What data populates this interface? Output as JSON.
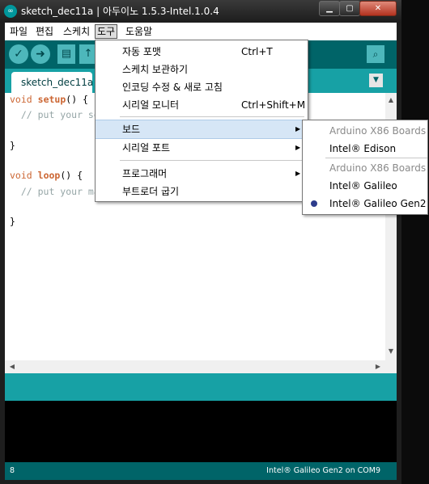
{
  "window": {
    "title": "sketch_dec11a | 아두이노 1.5.3-Intel.1.0.4",
    "app_icon_glyph": "∞",
    "min_glyph": "▁",
    "max_glyph": "▢",
    "close_glyph": "✕"
  },
  "menubar": {
    "items": [
      "파일",
      "편집",
      "스케치",
      "도구",
      "도움말"
    ],
    "active": "도구"
  },
  "toolbar": {
    "verify_glyph": "✓",
    "upload_glyph": "➜",
    "new_glyph": "▤",
    "open_glyph": "↑",
    "serial_glyph": "⌕"
  },
  "tabs": {
    "active_tab": "sketch_dec11a",
    "menu_glyph": "▼"
  },
  "editor": {
    "lines": [
      {
        "kw": "void",
        "fn": "setup",
        "rest": "() {"
      },
      {
        "comment": "  // put your setu"
      },
      {
        "text": ""
      },
      {
        "text": "}"
      },
      {
        "text": ""
      },
      {
        "kw": "void",
        "fn": "loop",
        "rest": "() {"
      },
      {
        "comment": "  // put your main"
      },
      {
        "text": ""
      },
      {
        "text": "}"
      }
    ]
  },
  "tools_menu": {
    "items": [
      {
        "label": "자동 포맷",
        "shortcut": "Ctrl+T"
      },
      {
        "label": "스케치 보관하기",
        "shortcut": ""
      },
      {
        "label": "인코딩 수정 & 새로 고침",
        "shortcut": ""
      },
      {
        "label": "시리얼 모니터",
        "shortcut": "Ctrl+Shift+M"
      },
      {
        "label": "보드",
        "submenu": true,
        "highlighted": true
      },
      {
        "label": "시리얼 포트",
        "submenu": true
      },
      {
        "label": "프로그래머",
        "submenu": true
      },
      {
        "label": "부트로더 굽기",
        "shortcut": ""
      }
    ],
    "submenu_arrow": "▶"
  },
  "board_submenu": {
    "items": [
      {
        "label": "Arduino X86 Boards",
        "type": "header"
      },
      {
        "label": "Intel® Edison",
        "type": "item"
      },
      {
        "label": "Arduino X86 Boards",
        "type": "header"
      },
      {
        "label": "Intel® Galileo",
        "type": "item"
      },
      {
        "label": "Intel® Galileo Gen2",
        "type": "item",
        "selected": true
      }
    ]
  },
  "status": {
    "line_number": "8",
    "board_port": "Intel® Galileo Gen2 on COM9"
  },
  "colors": {
    "toolbar": "#006468",
    "tabstrip": "#17a1a5",
    "keyword": "#cc6633",
    "comment": "#95a5a6"
  }
}
